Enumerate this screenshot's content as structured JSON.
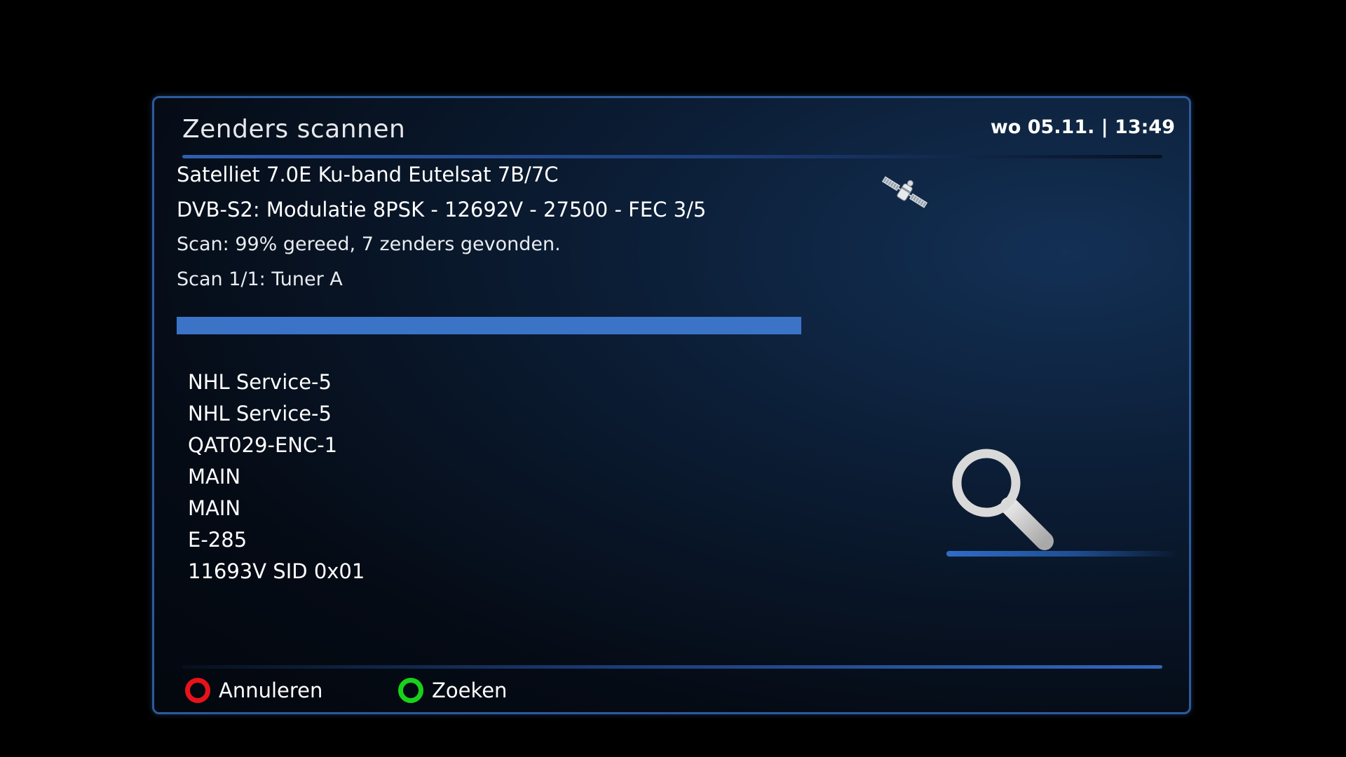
{
  "header": {
    "title": "Zenders scannen",
    "datetime": "wo 05.11. | 13:49"
  },
  "scan": {
    "satellite": "Satelliet 7.0E Ku-band Eutelsat 7B/7C",
    "transponder": "DVB-S2: Modulatie 8PSK - 12692V - 27500 - FEC 3/5",
    "status": "Scan: 99% gereed, 7 zenders gevonden.",
    "tuner": "Scan 1/1: Tuner A",
    "progress_percent": 99
  },
  "channels": [
    "NHL Service-5",
    "NHL Service-5",
    "QAT029-ENC-1",
    "MAIN",
    "MAIN",
    "E-285",
    "11693V SID 0x01"
  ],
  "icons": {
    "satellite": "satellite-icon",
    "search": "search-icon"
  },
  "footer": {
    "red_button": {
      "label": "Annuleren",
      "color": "#e8121b"
    },
    "green_button": {
      "label": "Zoeken",
      "color": "#18d21a"
    }
  },
  "colors": {
    "accent": "#3b73c7",
    "border": "#2e5a9c"
  }
}
